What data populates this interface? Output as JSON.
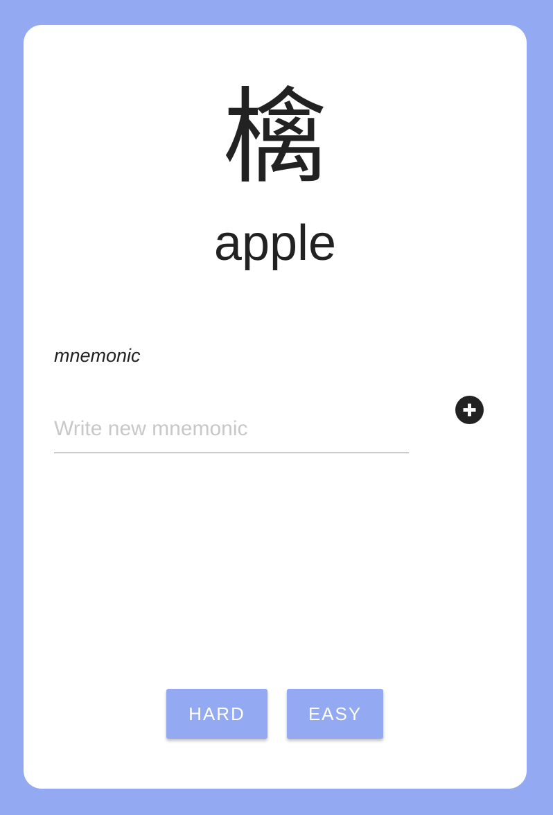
{
  "card": {
    "kanji": "檎",
    "meaning": "apple"
  },
  "mnemonic": {
    "label": "mnemonic",
    "placeholder": "Write new mnemonic",
    "value": "",
    "add_icon": "plus-circle-icon"
  },
  "actions": {
    "hard_label": "HARD",
    "easy_label": "EASY"
  },
  "colors": {
    "background": "#93aaf2",
    "card": "#ffffff",
    "text": "#222222",
    "button": "#93aaf2"
  }
}
